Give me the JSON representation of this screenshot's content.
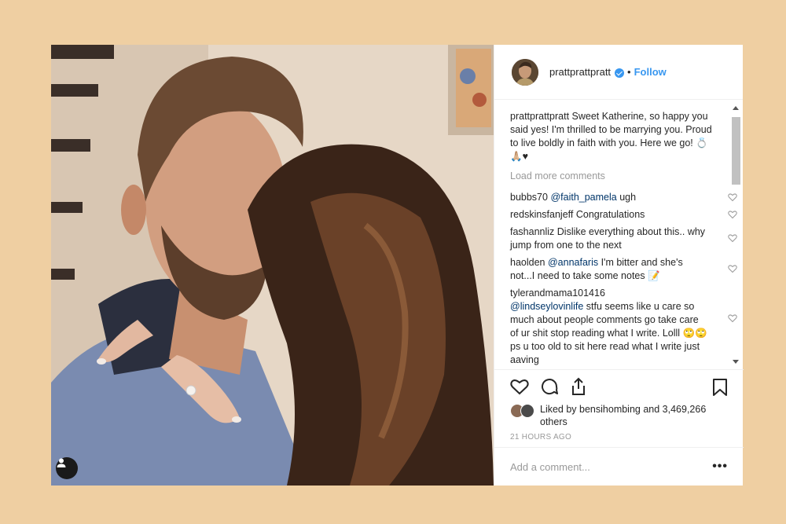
{
  "post": {
    "username": "prattprattpratt",
    "follow_label": "Follow",
    "dot": "•",
    "caption_user": "prattprattpratt",
    "caption_text": " Sweet Katherine, so happy you said yes! I'm thrilled to be marrying you. Proud to live boldly in faith with you. Here we go! 💍🙏🏼♥",
    "load_more": "Load more comments",
    "comments": [
      {
        "user": "bubbs70",
        "mention": "@faith_pamela",
        "text": " ugh"
      },
      {
        "user": "redskinsfanjeff",
        "mention": "",
        "text": " Congratulations"
      },
      {
        "user": "fashannliz",
        "mention": "",
        "text": " Dislike everything about this.. why jump from one to the next"
      },
      {
        "user": "haolden",
        "mention": "@annafaris",
        "text": " I'm bitter and she's not...I need to take some notes 📝"
      },
      {
        "user": "tylerandmama101416",
        "mention": "@lindseylovinlife",
        "text": " stfu seems like u care so much about people comments go take care of ur shit stop reading what I write. Lolll 🙄🙄ps u too old to sit here read what I write just aaving"
      }
    ],
    "likes_text": "Liked by bensihombing and 3,469,266 others",
    "time": "21 HOURS AGO",
    "add_comment_placeholder": "Add a comment...",
    "more_label": "•••"
  },
  "colors": {
    "background": "#efcfa2",
    "accent": "#3897f0",
    "mention": "#003569"
  }
}
